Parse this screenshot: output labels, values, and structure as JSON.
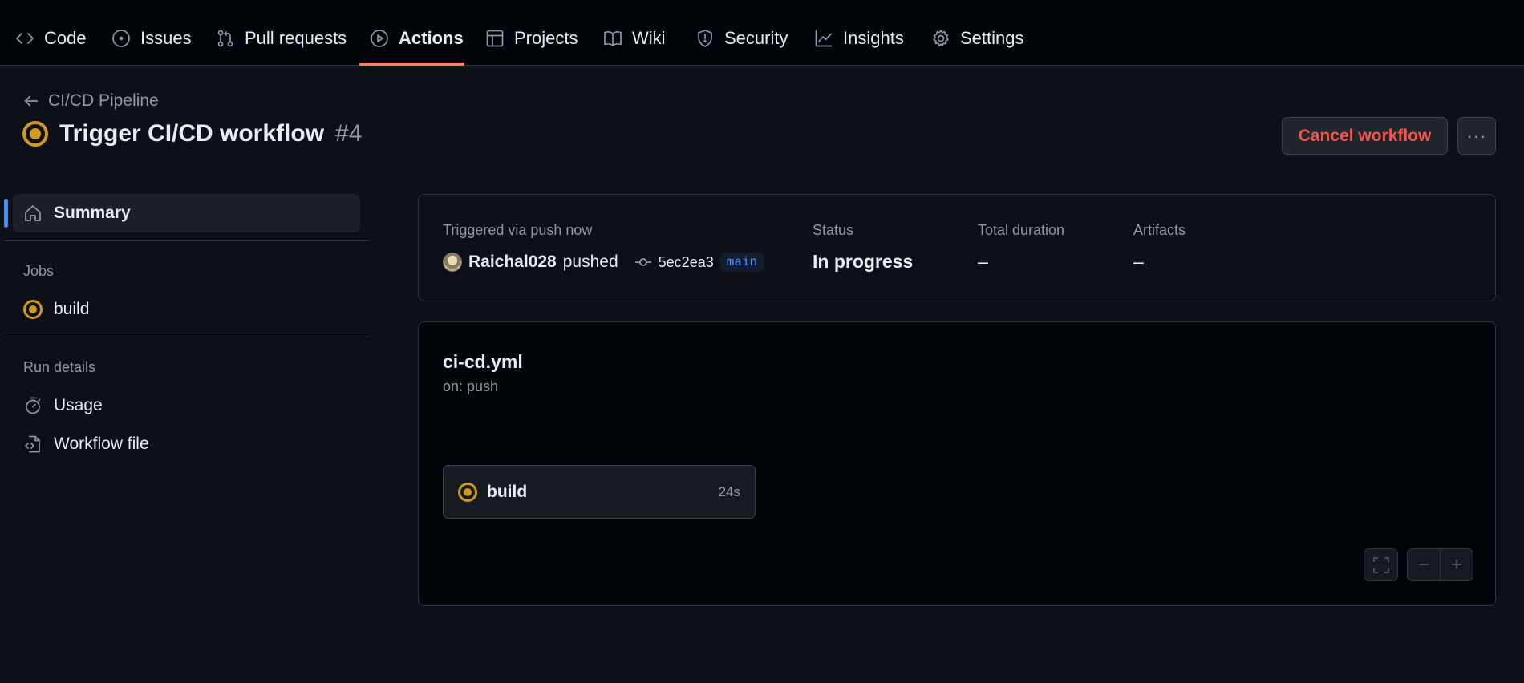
{
  "nav": {
    "tabs": [
      {
        "label": "Code",
        "icon": "code-icon"
      },
      {
        "label": "Issues",
        "icon": "issue-circle-icon"
      },
      {
        "label": "Pull requests",
        "icon": "git-pull-request-icon"
      },
      {
        "label": "Actions",
        "icon": "play-icon",
        "active": true
      },
      {
        "label": "Projects",
        "icon": "table-icon"
      },
      {
        "label": "Wiki",
        "icon": "book-icon"
      },
      {
        "label": "Security",
        "icon": "shield-icon"
      },
      {
        "label": "Insights",
        "icon": "graph-icon"
      },
      {
        "label": "Settings",
        "icon": "gear-icon"
      }
    ]
  },
  "header": {
    "back_label": "CI/CD Pipeline",
    "run_title": "Trigger CI/CD workflow",
    "run_number": "#4",
    "cancel_label": "Cancel workflow",
    "more_label": "···"
  },
  "sidebar": {
    "summary_label": "Summary",
    "jobs_heading": "Jobs",
    "jobs": [
      {
        "label": "build",
        "status": "in_progress"
      }
    ],
    "run_details_heading": "Run details",
    "details": [
      {
        "label": "Usage",
        "icon": "stopwatch-icon"
      },
      {
        "label": "Workflow file",
        "icon": "file-code-icon"
      }
    ]
  },
  "summary": {
    "trigger_label": "Triggered via push now",
    "user": "Raichal028",
    "action": "pushed",
    "commit": "5ec2ea3",
    "branch": "main",
    "status_label": "Status",
    "status_value": "In progress",
    "duration_label": "Total duration",
    "duration_value": "–",
    "artifacts_label": "Artifacts",
    "artifacts_value": "–"
  },
  "graph": {
    "workflow_file": "ci-cd.yml",
    "trigger": "on: push",
    "job": {
      "label": "build",
      "duration": "24s"
    },
    "zoom_out_label": "−",
    "zoom_in_label": "+"
  },
  "colors": {
    "accent_underline": "#f78166",
    "in_progress": "#d29922",
    "danger": "#f85149",
    "link": "#4493f8"
  }
}
